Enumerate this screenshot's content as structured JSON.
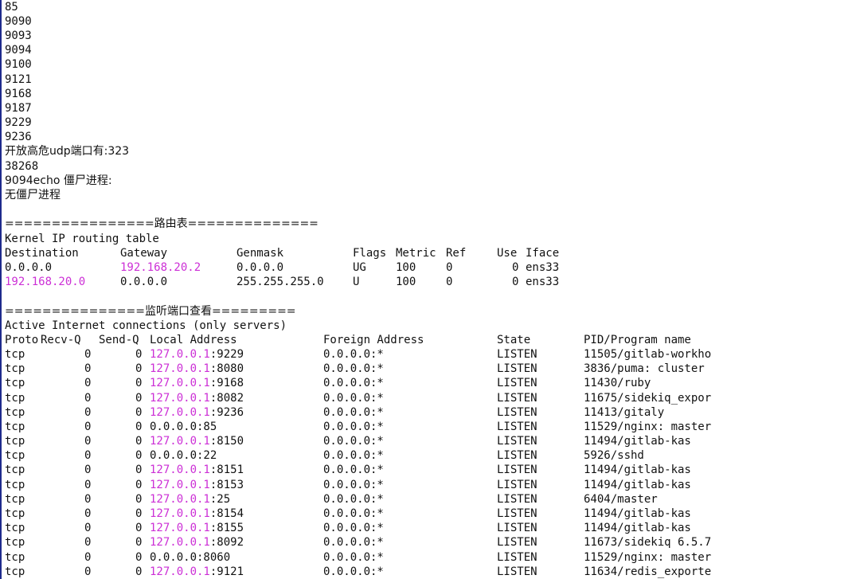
{
  "colors": {
    "background": "#ffffff",
    "text": "#111111",
    "ip_highlight": "#cc2fd6",
    "cursor_bar": "#1e2a8c"
  },
  "top_lines": [
    "85",
    "9090",
    "9093",
    "9094",
    "9100",
    "9121",
    "9168",
    "9187",
    "9229",
    "9236"
  ],
  "udp_line": "开放高危udp端口有:323",
  "udp_port_line": "38268",
  "zombie_line": "9094echo 僵尸进程:",
  "no_zombie_line": "无僵尸进程",
  "route_section": {
    "banner": "================路由表==============",
    "title": "Kernel IP routing table",
    "headers": [
      "Destination",
      "Gateway",
      "Genmask",
      "Flags",
      "Metric",
      "Ref",
      "Use",
      "Iface"
    ],
    "rows": [
      {
        "destination": "0.0.0.0",
        "gateway": "192.168.20.2",
        "genmask": "0.0.0.0",
        "flags": "UG",
        "metric": "100",
        "ref": "0",
        "use": "0",
        "iface": "ens33"
      },
      {
        "destination": "192.168.20.0",
        "gateway": "0.0.0.0",
        "genmask": "255.255.255.0",
        "flags": "U",
        "metric": "100",
        "ref": "0",
        "use": "0",
        "iface": "ens33"
      }
    ]
  },
  "listen_section": {
    "banner": "===============监听端口查看=========",
    "title": "Active Internet connections (only servers)",
    "headers": [
      "Proto",
      "Recv-Q",
      "Send-Q",
      "Local Address",
      "Foreign Address",
      "State",
      "PID/Program name"
    ],
    "rows": [
      {
        "proto": "tcp",
        "recvq": "0",
        "sendq": "0",
        "local_ip": "127.0.0.1",
        "local_port": ":9229",
        "foreign": "0.0.0.0:*",
        "state": "LISTEN",
        "program": "11505/gitlab-workho"
      },
      {
        "proto": "tcp",
        "recvq": "0",
        "sendq": "0",
        "local_ip": "127.0.0.1",
        "local_port": ":8080",
        "foreign": "0.0.0.0:*",
        "state": "LISTEN",
        "program": "3836/puma: cluster"
      },
      {
        "proto": "tcp",
        "recvq": "0",
        "sendq": "0",
        "local_ip": "127.0.0.1",
        "local_port": ":9168",
        "foreign": "0.0.0.0:*",
        "state": "LISTEN",
        "program": "11430/ruby"
      },
      {
        "proto": "tcp",
        "recvq": "0",
        "sendq": "0",
        "local_ip": "127.0.0.1",
        "local_port": ":8082",
        "foreign": "0.0.0.0:*",
        "state": "LISTEN",
        "program": "11675/sidekiq_expor"
      },
      {
        "proto": "tcp",
        "recvq": "0",
        "sendq": "0",
        "local_ip": "127.0.0.1",
        "local_port": ":9236",
        "foreign": "0.0.0.0:*",
        "state": "LISTEN",
        "program": "11413/gitaly"
      },
      {
        "proto": "tcp",
        "recvq": "0",
        "sendq": "0",
        "local_ip": "",
        "local_port": "0.0.0.0:85",
        "foreign": "0.0.0.0:*",
        "state": "LISTEN",
        "program": "11529/nginx: master"
      },
      {
        "proto": "tcp",
        "recvq": "0",
        "sendq": "0",
        "local_ip": "127.0.0.1",
        "local_port": ":8150",
        "foreign": "0.0.0.0:*",
        "state": "LISTEN",
        "program": "11494/gitlab-kas"
      },
      {
        "proto": "tcp",
        "recvq": "0",
        "sendq": "0",
        "local_ip": "",
        "local_port": "0.0.0.0:22",
        "foreign": "0.0.0.0:*",
        "state": "LISTEN",
        "program": "5926/sshd"
      },
      {
        "proto": "tcp",
        "recvq": "0",
        "sendq": "0",
        "local_ip": "127.0.0.1",
        "local_port": ":8151",
        "foreign": "0.0.0.0:*",
        "state": "LISTEN",
        "program": "11494/gitlab-kas"
      },
      {
        "proto": "tcp",
        "recvq": "0",
        "sendq": "0",
        "local_ip": "127.0.0.1",
        "local_port": ":8153",
        "foreign": "0.0.0.0:*",
        "state": "LISTEN",
        "program": "11494/gitlab-kas"
      },
      {
        "proto": "tcp",
        "recvq": "0",
        "sendq": "0",
        "local_ip": "127.0.0.1",
        "local_port": ":25",
        "foreign": "0.0.0.0:*",
        "state": "LISTEN",
        "program": "6404/master"
      },
      {
        "proto": "tcp",
        "recvq": "0",
        "sendq": "0",
        "local_ip": "127.0.0.1",
        "local_port": ":8154",
        "foreign": "0.0.0.0:*",
        "state": "LISTEN",
        "program": "11494/gitlab-kas"
      },
      {
        "proto": "tcp",
        "recvq": "0",
        "sendq": "0",
        "local_ip": "127.0.0.1",
        "local_port": ":8155",
        "foreign": "0.0.0.0:*",
        "state": "LISTEN",
        "program": "11494/gitlab-kas"
      },
      {
        "proto": "tcp",
        "recvq": "0",
        "sendq": "0",
        "local_ip": "127.0.0.1",
        "local_port": ":8092",
        "foreign": "0.0.0.0:*",
        "state": "LISTEN",
        "program": "11673/sidekiq 6.5.7"
      },
      {
        "proto": "tcp",
        "recvq": "0",
        "sendq": "0",
        "local_ip": "",
        "local_port": "0.0.0.0:8060",
        "foreign": "0.0.0.0:*",
        "state": "LISTEN",
        "program": "11529/nginx: master"
      },
      {
        "proto": "tcp",
        "recvq": "0",
        "sendq": "0",
        "local_ip": "127.0.0.1",
        "local_port": ":9121",
        "foreign": "0.0.0.0:*",
        "state": "LISTEN",
        "program": "11634/redis_exporte"
      }
    ]
  }
}
